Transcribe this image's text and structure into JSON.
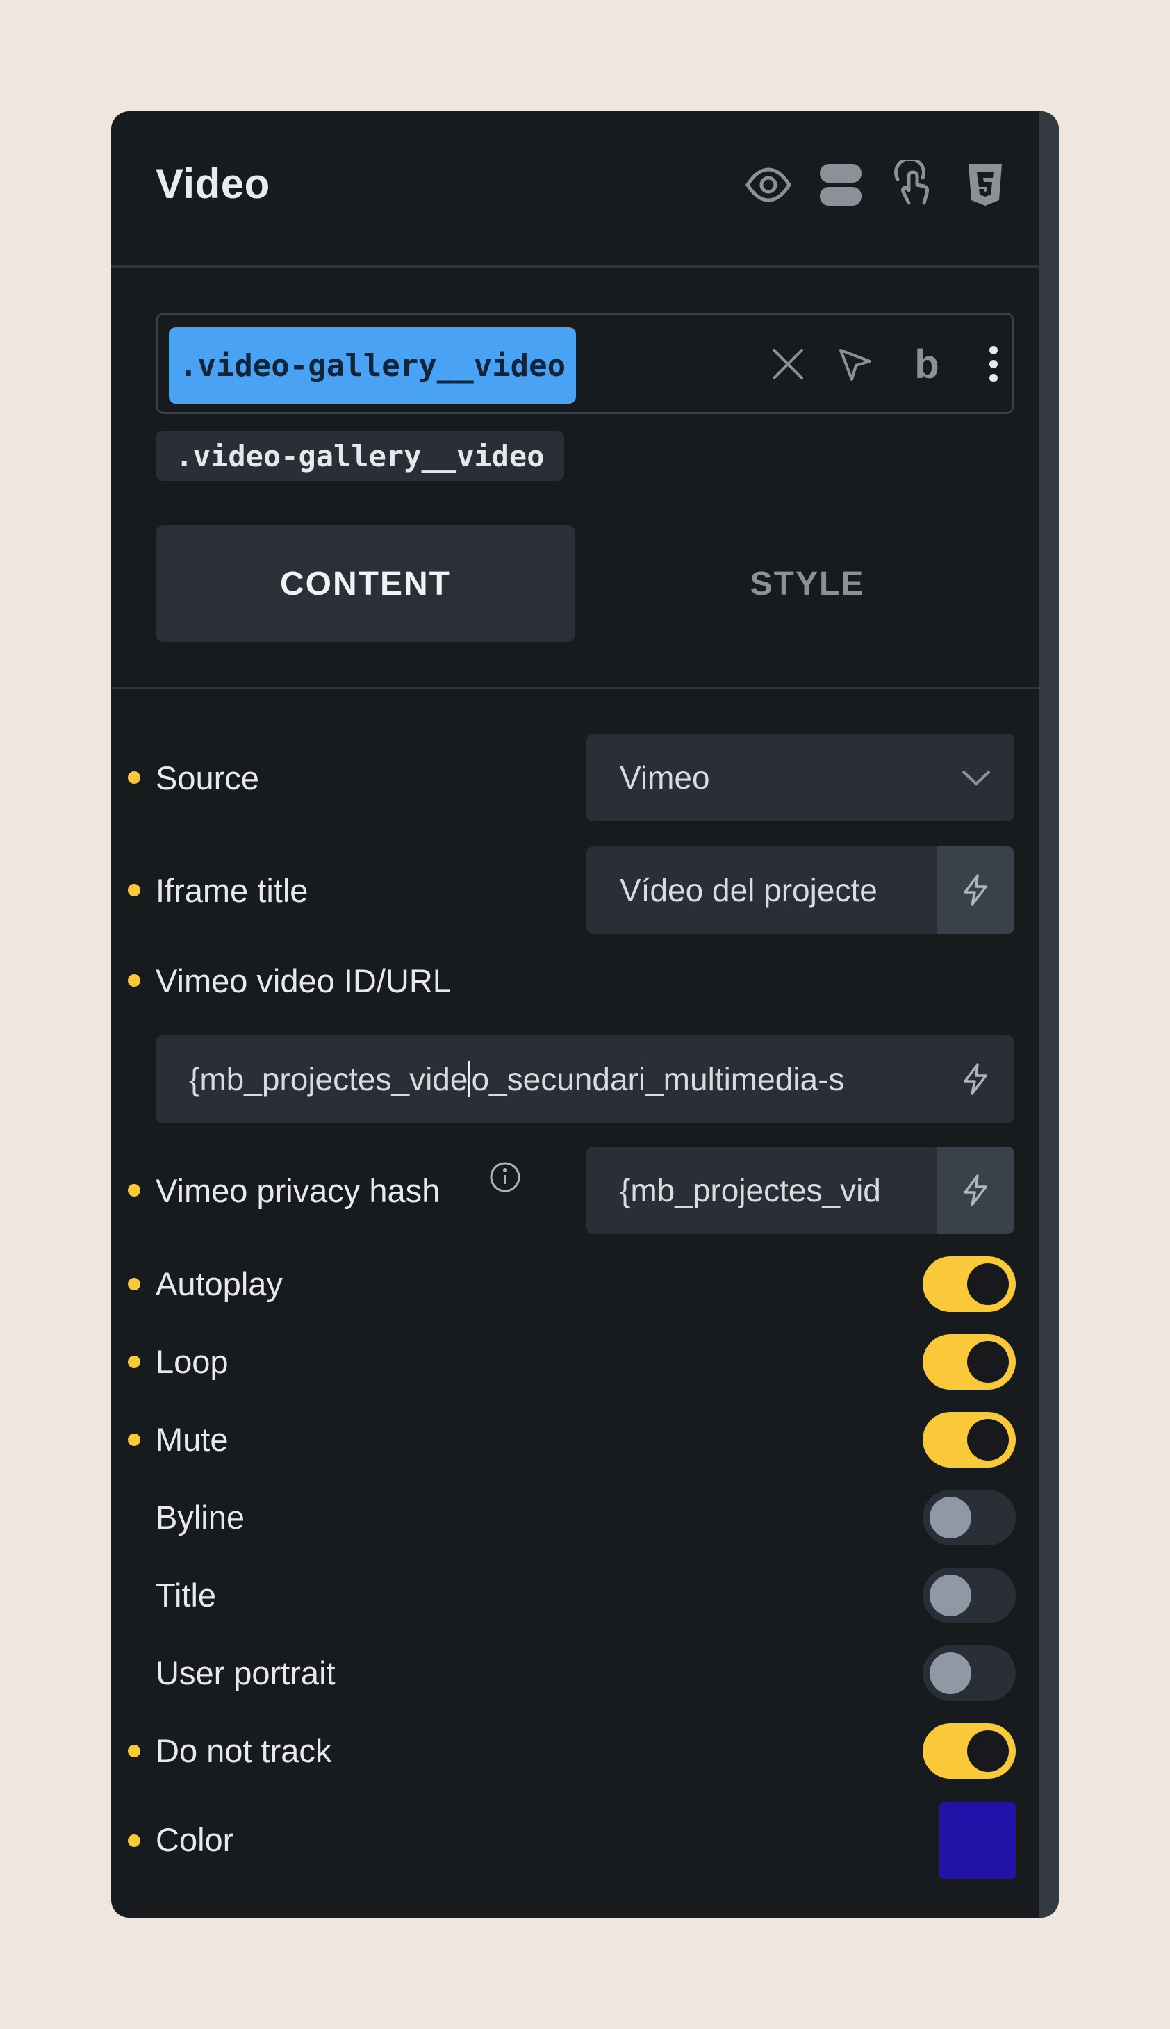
{
  "panel": {
    "title": "Video",
    "header_icons": [
      "eye-icon",
      "layers-icon",
      "touch-icon",
      "css3-icon"
    ]
  },
  "class_selector": {
    "active_class": ".video-gallery__video",
    "icons": [
      "close-icon",
      "cursor-icon",
      "bold-icon",
      "more-icon"
    ],
    "secondary_class": ".video-gallery__video"
  },
  "tabs": [
    {
      "label": "CONTENT",
      "active": true
    },
    {
      "label": "STYLE",
      "active": false
    }
  ],
  "fields": {
    "source": {
      "label": "Source",
      "value": "Vimeo"
    },
    "iframe_title": {
      "label": "Iframe title",
      "value": "Vídeo del projecte"
    },
    "vimeo_id": {
      "label": "Vimeo video ID/URL",
      "value_before_caret": "{mb_projectes_vide",
      "value_after_caret": "o_secundari_multimedia-s"
    },
    "privacy_hash": {
      "label": "Vimeo privacy hash",
      "value": "{mb_projectes_vid"
    },
    "autoplay": {
      "label": "Autoplay",
      "checked": true
    },
    "loop": {
      "label": "Loop",
      "checked": true
    },
    "mute": {
      "label": "Mute",
      "checked": true
    },
    "byline": {
      "label": "Byline",
      "checked": false
    },
    "title": {
      "label": "Title",
      "checked": false
    },
    "user_portrait": {
      "label": "User portrait",
      "checked": false
    },
    "do_not_track": {
      "label": "Do not track",
      "checked": true
    },
    "color": {
      "label": "Color",
      "value": "#2213a8"
    }
  },
  "colors": {
    "accent_yellow": "#f9c93a",
    "class_chip_blue": "#4aa2f5",
    "panel_bg": "#181b1e"
  }
}
